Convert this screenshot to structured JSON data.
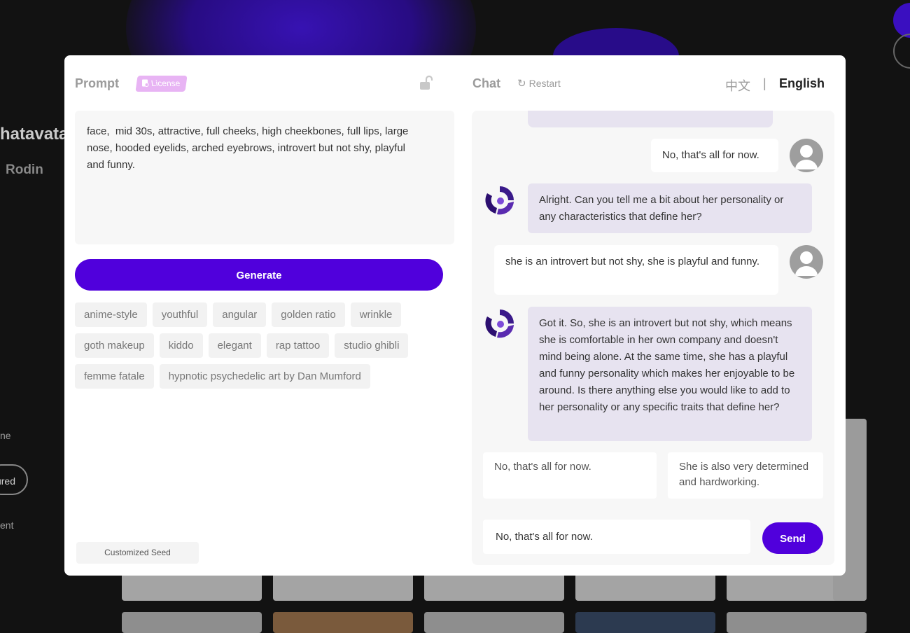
{
  "background": {
    "heading": "hatavata",
    "subheading": "Rodin",
    "nav_items": [
      "ne",
      "ured",
      "ent"
    ]
  },
  "prompt": {
    "title": "Prompt",
    "license_label": "License",
    "text": "face,  mid 30s, attractive, full cheeks, high cheekbones, full lips, large\nnose, hooded eyelids, arched eyebrows, introvert but not shy, playful\nand funny.",
    "generate_label": "Generate",
    "tags": [
      "anime-style",
      "youthful",
      "angular",
      "golden ratio",
      "wrinkle",
      "goth makeup",
      "kiddo",
      "elegant",
      "rap tattoo",
      "studio ghibli",
      "femme fatale",
      "hypnotic psychedelic art by Dan Mumford"
    ],
    "seed_label": "Customized Seed"
  },
  "chat": {
    "title": "Chat",
    "restart_label": "Restart",
    "lang_cn": "中文",
    "lang_sep": "|",
    "lang_en": "English",
    "messages": [
      {
        "role": "user",
        "text": "No, that's all for now."
      },
      {
        "role": "bot",
        "text": "Alright. Can you tell me a bit about her personality or any characteristics that define her?"
      },
      {
        "role": "user",
        "text": "she is an introvert but not shy, she is playful and funny."
      },
      {
        "role": "bot",
        "text": "Got it. So, she is an introvert but not shy, which means she is comfortable in her own company and doesn't mind being alone. At the same time, she has a playful and funny personality which makes her enjoyable to be around. Is there anything else you would like to add to her personality or any specific traits that define her?"
      }
    ],
    "suggestions": [
      "No, that's all for now.",
      "She is also very determined and hardworking."
    ],
    "input_value": "No, that's all for now.",
    "send_label": "Send"
  },
  "colors": {
    "accent": "#5000dc",
    "bot_bubble": "#e7e3f0",
    "license_badge": "#e8b4f4"
  }
}
